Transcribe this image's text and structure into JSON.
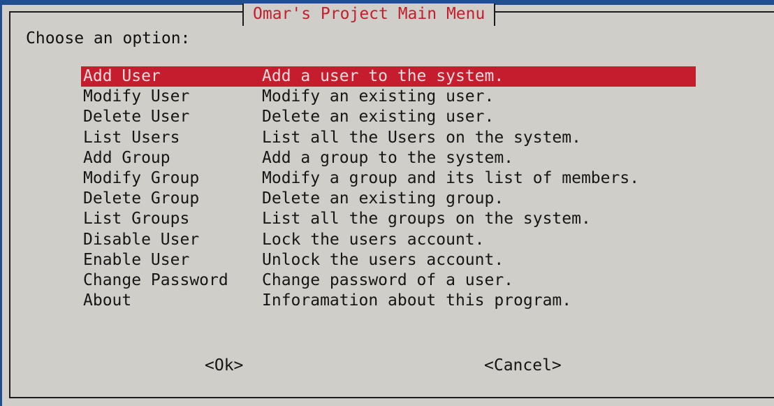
{
  "dialog": {
    "title": "Omar's Project Main Menu",
    "prompt": "Choose an option:"
  },
  "menu": {
    "items": [
      {
        "tag": "Add User",
        "desc": "Add a user to the system."
      },
      {
        "tag": "Modify User",
        "desc": "Modify an existing user."
      },
      {
        "tag": "Delete User",
        "desc": "Delete an existing user."
      },
      {
        "tag": "List Users",
        "desc": "List all the Users on the system."
      },
      {
        "tag": "Add Group",
        "desc": "Add a group to the system."
      },
      {
        "tag": "Modify Group",
        "desc": "Modify a group and its list of members."
      },
      {
        "tag": "Delete Group",
        "desc": "Delete an existing group."
      },
      {
        "tag": "List Groups",
        "desc": "List all the groups on the system."
      },
      {
        "tag": "Disable User",
        "desc": "Lock the users account."
      },
      {
        "tag": "Enable User",
        "desc": "Unlock the users account."
      },
      {
        "tag": "Change Password",
        "desc": "Change password of a user."
      },
      {
        "tag": "About",
        "desc": "Inforamation about this program."
      }
    ],
    "selected_index": 0
  },
  "buttons": {
    "ok": "<Ok>",
    "cancel": "<Cancel>"
  },
  "colors": {
    "background": "#1f4f8e",
    "dialog": "#d0cec8",
    "accent": "#c51d2e",
    "selected_text": "#f3dadd"
  }
}
